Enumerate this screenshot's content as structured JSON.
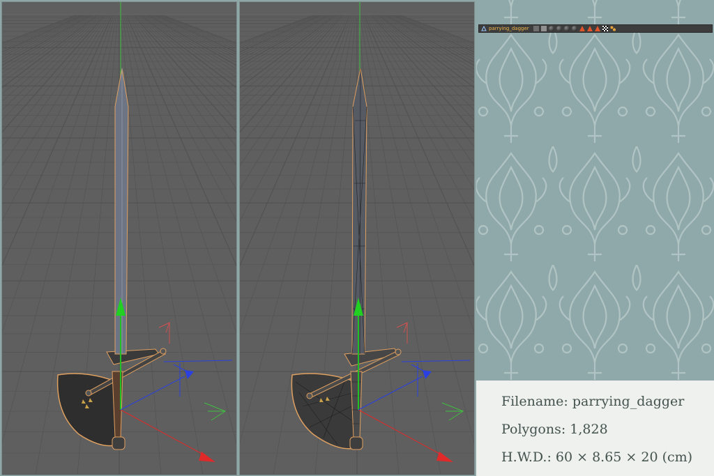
{
  "outliner": {
    "object_name": "parrying_dagger",
    "tags": [
      "null-object-icon",
      "edit-tag",
      "lock-tag",
      "material-ball-1",
      "material-ball-2",
      "material-ball-3",
      "material-ball-4",
      "phong-triangle-1",
      "phong-triangle-2",
      "phong-triangle-3",
      "checker-tag",
      "texture-tag"
    ]
  },
  "info": {
    "filename": "Filename: parrying_dagger",
    "polygons": "Polygons: 1,828",
    "dimensions": "H.W.D.: 60 × 8.65 × 20 (cm)"
  },
  "colors": {
    "viewport_bg": "#5f5f5f",
    "grid_line": "#525252",
    "selection_outline": "#e0a060",
    "axis_y": "#22c022",
    "axis_x": "#e02a2a",
    "axis_z": "#2a40e0",
    "panel_bg": "#8fa8a9",
    "info_text": "#44524f"
  }
}
